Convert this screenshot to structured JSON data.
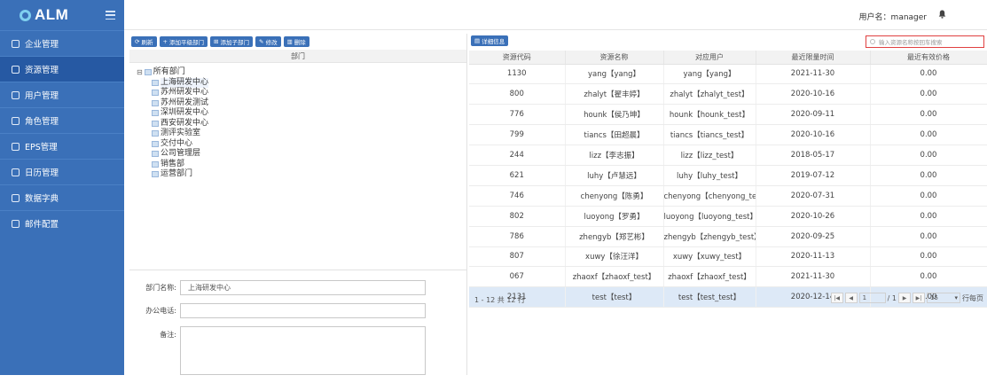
{
  "app": {
    "logo_text": "ALM"
  },
  "sidebar": {
    "items": [
      {
        "label": "企业管理",
        "icon": "building-icon"
      },
      {
        "label": "资源管理",
        "icon": "org-chart-icon",
        "active": true
      },
      {
        "label": "用户管理",
        "icon": "users-icon"
      },
      {
        "label": "角色管理",
        "icon": "role-icon"
      },
      {
        "label": "EPS管理",
        "icon": "folder-icon"
      },
      {
        "label": "日历管理",
        "icon": "calendar-icon"
      },
      {
        "label": "数据字典",
        "icon": "dictionary-icon"
      },
      {
        "label": "邮件配置",
        "icon": "mail-icon"
      }
    ]
  },
  "header": {
    "user_label": "用户名：manager"
  },
  "toolbar": {
    "refresh": "刷新",
    "add_dept": "添加平级部门",
    "add_child": "添加子部门",
    "edit": "修改",
    "delete": "删除"
  },
  "dept_tree": {
    "header": "部门",
    "root": "所有部门",
    "children": [
      "上海研发中心",
      "苏州研发中心",
      "苏州研发测试",
      "深圳研发中心",
      "西安研发中心",
      "测评实验室",
      "交付中心",
      "公司管理层",
      "销售部",
      "运营部门"
    ],
    "selected": "上海研发中心"
  },
  "form": {
    "dept_name_label": "部门名称:",
    "dept_name_value": "上海研发中心",
    "phone_label": "办公电话:",
    "phone_value": "",
    "note_label": "备注:"
  },
  "resources": {
    "detail_button": "详细信息",
    "search_placeholder": "输入资源名称按回车搜索",
    "columns": [
      "资源代码",
      "资源名称",
      "对应用户",
      "最近限量时间",
      "最近有效价格"
    ],
    "rows": [
      [
        "1130",
        "yang【yang】",
        "yang【yang】",
        "2021-11-30",
        "0.00"
      ],
      [
        "800",
        "zhalyt【翟丰婷】",
        "zhalyt【zhalyt_test】",
        "2020-10-16",
        "0.00"
      ],
      [
        "776",
        "hounk【侯乃坤】",
        "hounk【hounk_test】",
        "2020-09-11",
        "0.00"
      ],
      [
        "799",
        "tiancs【田超晨】",
        "tiancs【tiancs_test】",
        "2020-10-16",
        "0.00"
      ],
      [
        "244",
        "lizz【李志振】",
        "lizz【lizz_test】",
        "2018-05-17",
        "0.00"
      ],
      [
        "621",
        "luhy【卢慧远】",
        "luhy【luhy_test】",
        "2019-07-12",
        "0.00"
      ],
      [
        "746",
        "chenyong【陈勇】",
        "chenyong【chenyong_te...",
        "2020-07-31",
        "0.00"
      ],
      [
        "802",
        "luoyong【罗勇】",
        "luoyong【luoyong_test】",
        "2020-10-26",
        "0.00"
      ],
      [
        "786",
        "zhengyb【郑艺彬】",
        "zhengyb【zhengyb_test】",
        "2020-09-25",
        "0.00"
      ],
      [
        "807",
        "xuwy【徐汪洋】",
        "xuwy【xuwy_test】",
        "2020-11-13",
        "0.00"
      ],
      [
        "067",
        "zhaoxf【zhaoxf_test】",
        "zhaoxf【zhaoxf_test】",
        "2021-11-30",
        "0.00"
      ],
      [
        "2131",
        "test【test】",
        "test【test_test】",
        "2020-12-14",
        "0.00"
      ]
    ],
    "selected_row": 11
  },
  "pager": {
    "info": "1 - 12 共 12 行",
    "page": "1",
    "total_pages": "/ 1",
    "page_size": "15",
    "per_page_label": "行每页"
  },
  "colors": {
    "sidebar": "#3a70b8",
    "sidebar_active": "#2659a3",
    "accent": "#3a70b8",
    "selected_row": "#dde9f7",
    "search_border": "#e04040"
  }
}
